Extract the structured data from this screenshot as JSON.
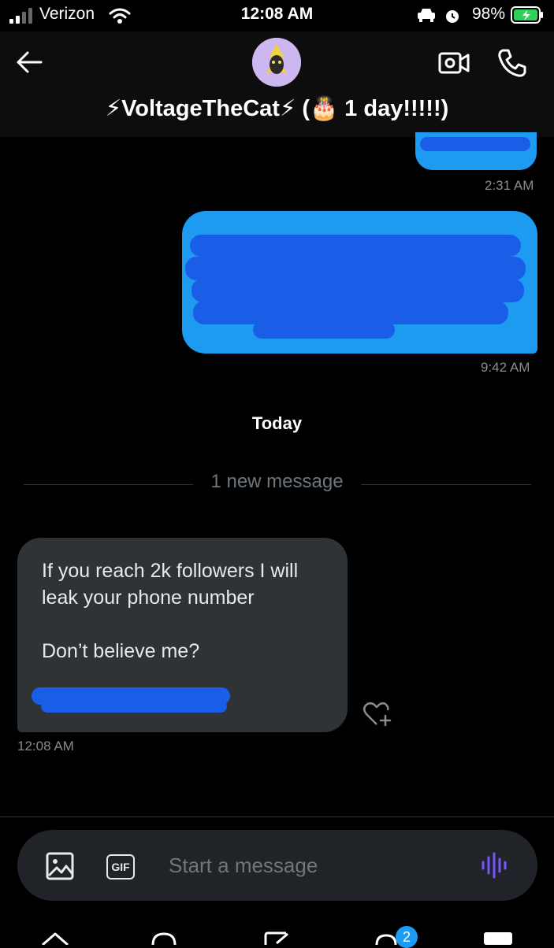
{
  "status_bar": {
    "carrier": "Verizon",
    "time": "12:08 AM",
    "battery_percent": "98%"
  },
  "header": {
    "contact_title": "⚡VoltageTheCat⚡ (🎂 1 day!!!!!)"
  },
  "messages": [
    {
      "direction": "outgoing",
      "timestamp": "2:31 AM",
      "content": ""
    },
    {
      "direction": "outgoing",
      "timestamp": "9:42 AM",
      "content": ""
    },
    {
      "direction": "incoming",
      "timestamp": "12:08 AM",
      "text": "If you reach 2k followers I will\nleak your phone number\n\nDon’t believe me?"
    }
  ],
  "day_separator": "Today",
  "new_message_divider": "1 new message",
  "composer": {
    "placeholder": "Start a message",
    "gif_label": "GIF"
  },
  "tabbar": {
    "messages_badge": "2"
  },
  "colors": {
    "accent": "#1d9bf0",
    "incoming_bubble": "#2f3336",
    "voice_icon": "#7856ff"
  }
}
